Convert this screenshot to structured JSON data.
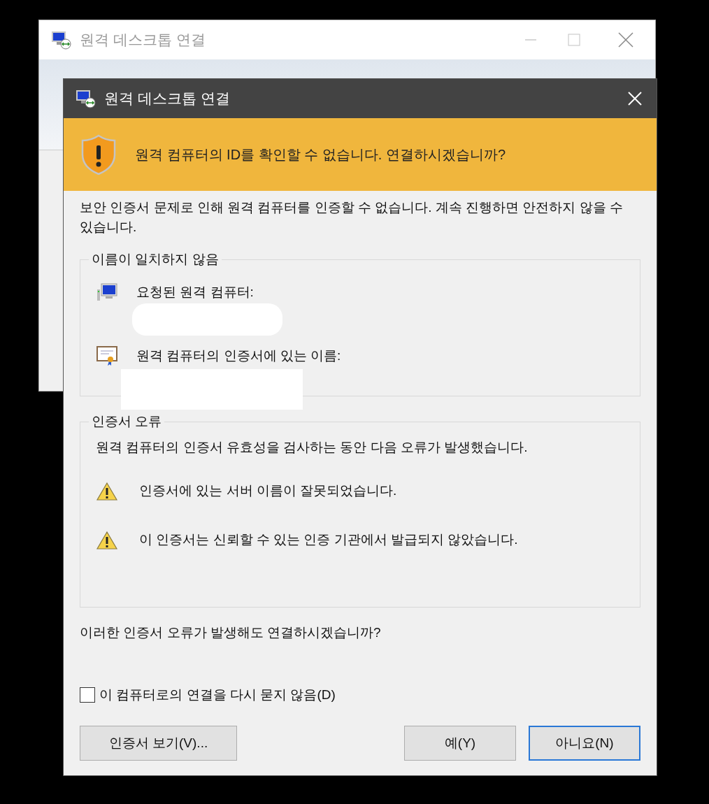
{
  "back_window": {
    "title": "원격 데스크톱 연결"
  },
  "dialog": {
    "title": "원격 데스크톱 연결",
    "banner": "원격 컴퓨터의 ID를 확인할 수 없습니다. 연결하시겠습니까?",
    "message": "보안 인증서 문제로 인해 원격 컴퓨터를 인증할 수 없습니다. 계속 진행하면 안전하지 않을 수 있습니다.",
    "groups": [
      {
        "title": "이름이 일치하지 않음",
        "items": [
          {
            "kind": "computer",
            "label": "요청된 원격 컴퓨터:"
          },
          {
            "kind": "certificate",
            "label": "원격 컴퓨터의 인증서에 있는 이름:"
          }
        ]
      },
      {
        "title": "인증서 오류",
        "description": "원격 컴퓨터의 인증서 유효성을 검사하는 동안 다음 오류가 발생했습니다.",
        "items": [
          {
            "kind": "warning",
            "label": "인증서에 있는 서버 이름이 잘못되었습니다."
          },
          {
            "kind": "warning",
            "label": "이 인증서는 신뢰할 수 있는 인증 기관에서 발급되지 않았습니다."
          }
        ]
      }
    ],
    "question": "이러한 인증서 오류가 발생해도 연결하시겠습니까?",
    "checkbox": {
      "label": "이 컴퓨터로의 연결을 다시 묻지 않음(D)",
      "checked": false
    },
    "buttons": [
      {
        "label": "인증서 보기(V)...",
        "focused": false
      },
      {
        "label": "예(Y)",
        "focused": false
      },
      {
        "label": "아니요(N)",
        "focused": true
      }
    ]
  }
}
